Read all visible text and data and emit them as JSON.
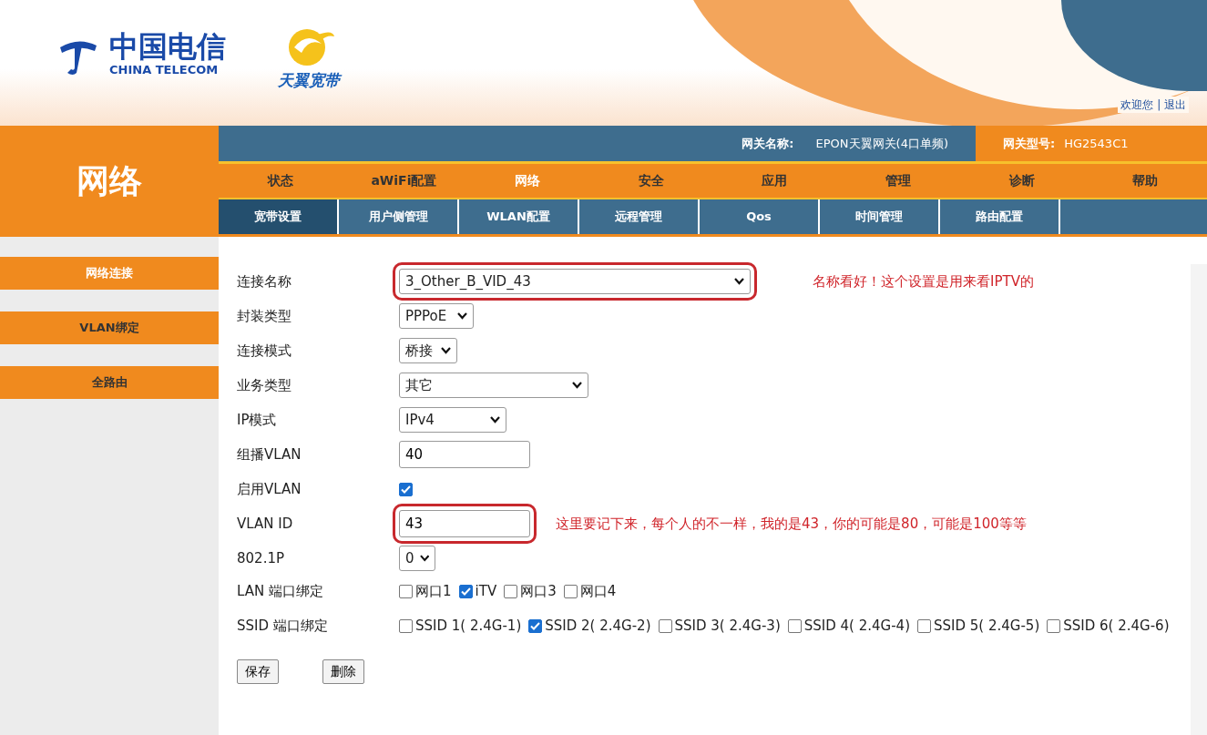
{
  "header": {
    "logo_cn": "中国电信",
    "logo_en": "CHINA TELECOM",
    "brand": "天翼宽带",
    "links": "欢迎您 | 退出"
  },
  "section_title": "网络",
  "gateway": {
    "name_label": "网关名称:",
    "name_value": "EPON天翼网关(4口单频)",
    "model_label": "网关型号:",
    "model_value": "HG2543C1"
  },
  "nav": [
    {
      "label": "状态",
      "selected": false
    },
    {
      "label": "aWiFi配置",
      "selected": false
    },
    {
      "label": "网络",
      "selected": true
    },
    {
      "label": "安全",
      "selected": false
    },
    {
      "label": "应用",
      "selected": false
    },
    {
      "label": "管理",
      "selected": false
    },
    {
      "label": "诊断",
      "selected": false
    },
    {
      "label": "帮助",
      "selected": false
    }
  ],
  "subnav": [
    {
      "label": "宽带设置",
      "selected": true
    },
    {
      "label": "用户侧管理",
      "selected": false
    },
    {
      "label": "WLAN配置",
      "selected": false
    },
    {
      "label": "远程管理",
      "selected": false
    },
    {
      "label": "Qos",
      "selected": false
    },
    {
      "label": "时间管理",
      "selected": false
    },
    {
      "label": "路由配置",
      "selected": false
    }
  ],
  "sidebar": [
    {
      "label": "网络连接",
      "selected": true
    },
    {
      "label": "VLAN绑定",
      "selected": false
    },
    {
      "label": "全路由",
      "selected": false
    }
  ],
  "fields": [
    {
      "kind": "select",
      "label": "连接名称",
      "value": "3_Other_B_VID_43",
      "highlighted": true,
      "note": "名称看好！这个设置是用来看IPTV的"
    },
    {
      "kind": "select",
      "label": "封装类型",
      "value": "PPPoE"
    },
    {
      "kind": "select",
      "label": "连接模式",
      "value": "桥接"
    },
    {
      "kind": "select",
      "label": "业务类型",
      "value": "其它"
    },
    {
      "kind": "select",
      "label": "IP模式",
      "value": "IPv4"
    },
    {
      "kind": "text",
      "label": "组播VLAN",
      "value": "40"
    },
    {
      "kind": "checkbox",
      "label": "启用VLAN",
      "checked": true
    },
    {
      "kind": "text",
      "label": "VLAN ID",
      "value": "43",
      "highlighted": true,
      "note": "这里要记下来，每个人的不一样，我的是43，你的可能是80，可能是100等等"
    },
    {
      "kind": "select",
      "label": "802.1P",
      "value": "0"
    },
    {
      "kind": "checkgroup",
      "label": "LAN 端口绑定",
      "options": [
        {
          "label": "网口1",
          "checked": false
        },
        {
          "label": "iTV",
          "checked": true
        },
        {
          "label": "网口3",
          "checked": false
        },
        {
          "label": "网口4",
          "checked": false
        }
      ]
    },
    {
      "kind": "checkgroup",
      "label": "SSID 端口绑定",
      "options": [
        {
          "label": "SSID 1( 2.4G-1)",
          "checked": false
        },
        {
          "label": "SSID 2( 2.4G-2)",
          "checked": true
        },
        {
          "label": "SSID 3( 2.4G-3)",
          "checked": false
        },
        {
          "label": "SSID 4( 2.4G-4)",
          "checked": false
        },
        {
          "label": "SSID 5( 2.4G-5)",
          "checked": false
        },
        {
          "label": "SSID 6( 2.4G-6)",
          "checked": false
        }
      ]
    }
  ],
  "buttons": [
    "保存",
    "删除"
  ]
}
